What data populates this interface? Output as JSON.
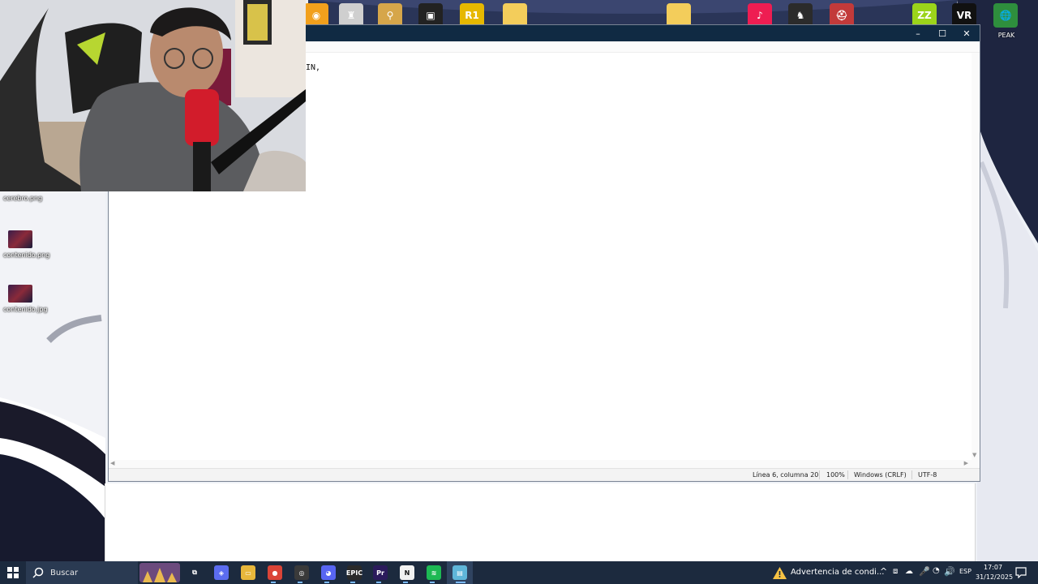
{
  "desktop": {
    "top_icons": [
      {
        "name": "game-icon-1",
        "color": "#f2a01c",
        "glyph": "◉"
      },
      {
        "name": "game-icon-2",
        "color": "#cfcfcf",
        "glyph": "♜"
      },
      {
        "name": "game-icon-3",
        "color": "#d6a64a",
        "glyph": "⚲"
      },
      {
        "name": "roblox-icon",
        "color": "#222222",
        "glyph": "▣"
      },
      {
        "name": "rocket-league-icon",
        "color": "#e6b800",
        "glyph": "R1"
      },
      {
        "name": "folder-icon",
        "color": "#f3cd5b",
        "glyph": ""
      },
      {
        "name": "folder-icon",
        "color": "#f3cd5b",
        "glyph": ""
      },
      {
        "name": "tiktok-icon",
        "color": "#ee1d52",
        "glyph": "♪"
      },
      {
        "name": "hollow-knight-icon",
        "color": "#2b2b2b",
        "glyph": "♞"
      },
      {
        "name": "game-helmet-icon",
        "color": "#c23a3a",
        "glyph": "⛑"
      },
      {
        "name": "zenless-icon",
        "color": "#9bd41a",
        "glyph": "ZZ"
      },
      {
        "name": "vr-icon",
        "color": "#111111",
        "glyph": "VR"
      },
      {
        "name": "peak-icon",
        "color": "#2e8f3d",
        "glyph": "🌐"
      }
    ],
    "peak_label": "PEAK",
    "icons": [
      {
        "label": "cerebro.png"
      },
      {
        "label": "contenido.png"
      },
      {
        "label": "contenido.jpg"
      }
    ]
  },
  "notepad": {
    "text_line": "IN,",
    "minimize_glyph": "–",
    "maximize_glyph": "☐",
    "close_glyph": "✕",
    "status": {
      "position": "Línea 6, columna 20",
      "zoom": "100%",
      "line_ending": "Windows (CRLF)",
      "encoding": "UTF-8"
    }
  },
  "taskbar": {
    "search_placeholder": "Buscar",
    "apps": [
      {
        "name": "task-view-icon",
        "glyph": "⧉",
        "color": "#1c2a3e"
      },
      {
        "name": "copilot-icon",
        "glyph": "◈",
        "color": "#5b6cf0"
      },
      {
        "name": "file-explorer-icon",
        "glyph": "▭",
        "color": "#e8b73b"
      },
      {
        "name": "chrome-icon",
        "glyph": "●",
        "color": "#db4437"
      },
      {
        "name": "obs-icon",
        "glyph": "◎",
        "color": "#3a3a3a"
      },
      {
        "name": "discord-icon",
        "glyph": "◕",
        "color": "#5865f2"
      },
      {
        "name": "epic-games-icon",
        "glyph": "EPIC",
        "color": "#2a2a2a"
      },
      {
        "name": "premiere-icon",
        "glyph": "Pr",
        "color": "#2b1b5c"
      },
      {
        "name": "notion-icon",
        "glyph": "N",
        "color": "#f1f1f1"
      },
      {
        "name": "spotify-icon",
        "glyph": "≋",
        "color": "#1db954"
      },
      {
        "name": "notepad-icon",
        "glyph": "▤",
        "color": "#5fb6d9"
      }
    ],
    "warning": "Advertencia de condi...",
    "language": "ESP",
    "time": "17:07",
    "date": "31/12/2025",
    "colors": {
      "background": "#1c2a3e",
      "accent": "#79b8ff"
    }
  }
}
